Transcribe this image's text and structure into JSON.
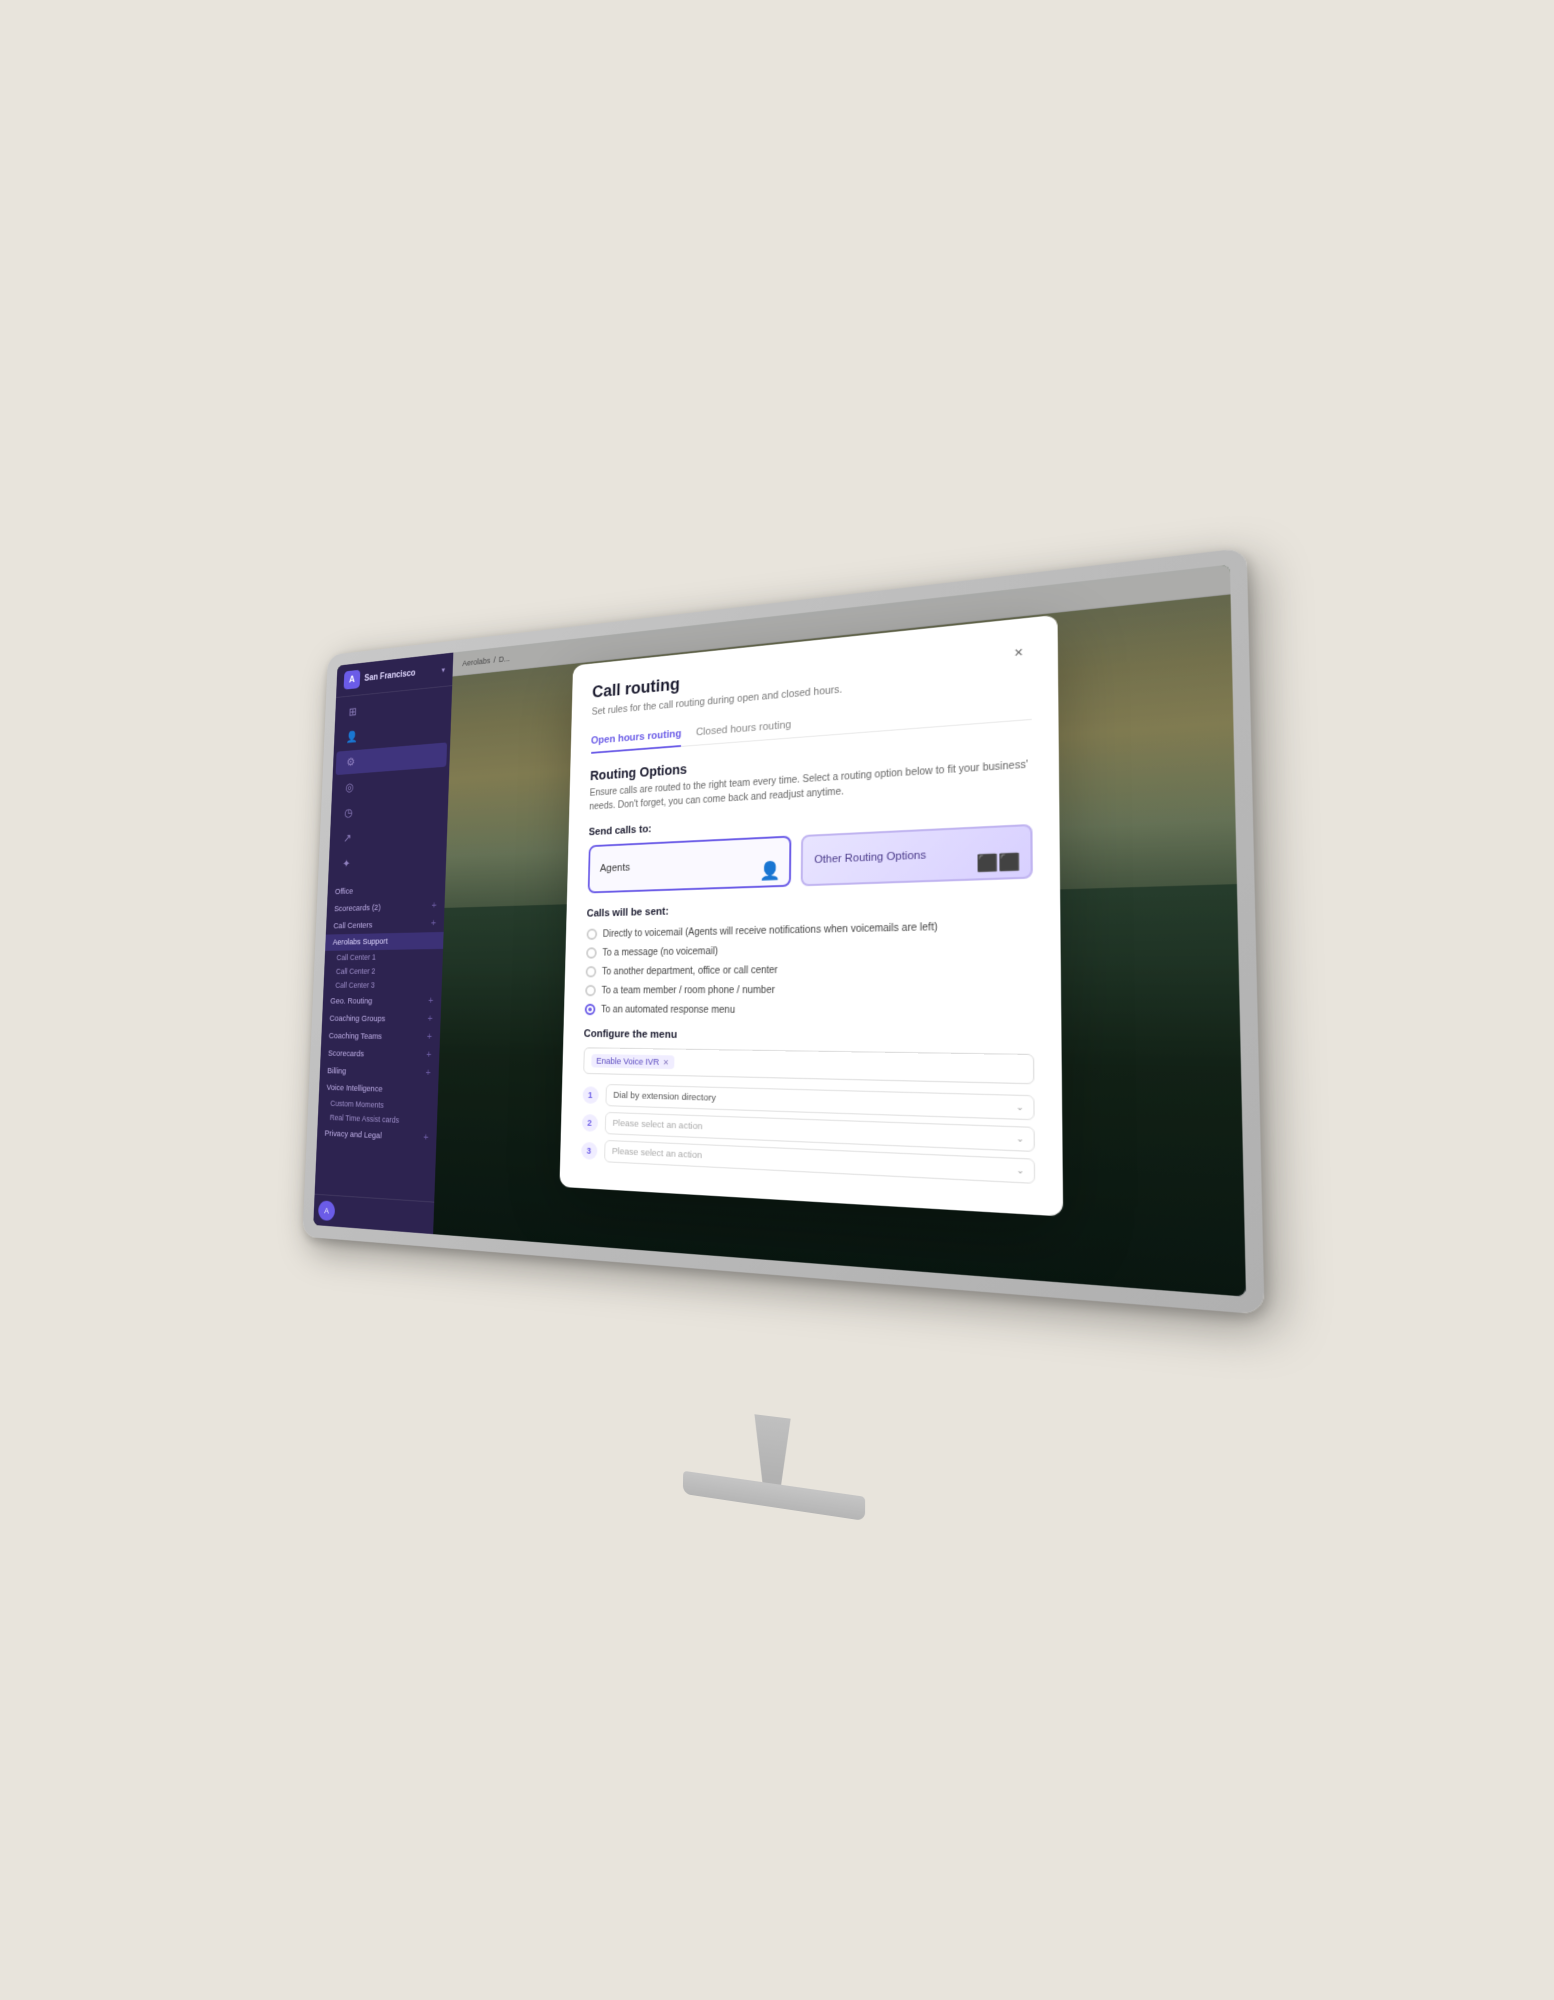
{
  "monitor": {
    "title": "Monitor display"
  },
  "sidebar": {
    "org_name": "San Francisco",
    "logo_text": "A",
    "nav_icons": [
      {
        "name": "grid-icon",
        "symbol": "⊞"
      },
      {
        "name": "users-icon",
        "symbol": "👤"
      },
      {
        "name": "settings-icon",
        "symbol": "⚙"
      },
      {
        "name": "headset-icon",
        "symbol": "🎧"
      },
      {
        "name": "clock-icon",
        "symbol": "◷"
      },
      {
        "name": "chart-icon",
        "symbol": "📈"
      },
      {
        "name": "tools-icon",
        "symbol": "🔧"
      }
    ],
    "items": [
      {
        "label": "Office",
        "indent": 0,
        "has_plus": false
      },
      {
        "label": "Scorecards (2)",
        "indent": 0,
        "has_plus": true
      },
      {
        "label": "Call Centers",
        "indent": 0,
        "has_plus": true
      },
      {
        "label": "Aerolabs Support",
        "indent": 0,
        "has_plus": false,
        "active": true
      },
      {
        "label": "Call Center 1",
        "indent": 1,
        "has_plus": false
      },
      {
        "label": "Call Center 2",
        "indent": 1,
        "has_plus": false
      },
      {
        "label": "Call Center 3",
        "indent": 1,
        "has_plus": false
      },
      {
        "label": "Geo. Routing",
        "indent": 0,
        "has_plus": true
      },
      {
        "label": "Coaching Groups",
        "indent": 0,
        "has_plus": true
      },
      {
        "label": "Coaching Teams",
        "indent": 0,
        "has_plus": true
      },
      {
        "label": "Scorecards",
        "indent": 0,
        "has_plus": true
      },
      {
        "label": "Billing",
        "indent": 0,
        "has_plus": true
      },
      {
        "label": "Voice Intelligence",
        "indent": 0,
        "has_plus": false
      },
      {
        "label": "Custom Moments",
        "indent": 1,
        "has_plus": false
      },
      {
        "label": "Real Time Assist cards",
        "indent": 1,
        "has_plus": false
      },
      {
        "label": "Privacy and Legal",
        "indent": 0,
        "has_plus": true
      }
    ]
  },
  "breadcrumb": {
    "items": [
      "Aerolabs",
      "/",
      "D..."
    ]
  },
  "modal": {
    "title": "Call routing",
    "subtitle": "Set rules for the call routing during open and closed hours.",
    "close_label": "×",
    "tabs": [
      {
        "label": "Open hours routing",
        "active": true
      },
      {
        "label": "Closed hours routing",
        "active": false
      }
    ],
    "routing_options": {
      "title": "Routing Options",
      "description": "Ensure calls are routed to the right team every time. Select a routing option below to fit your business' needs. Don't forget, you can come back and readjust anytime.",
      "send_calls_label": "Send calls to:",
      "cards": [
        {
          "label": "Agents",
          "selected": true,
          "type": "agents"
        },
        {
          "label": "Other Routing Options",
          "selected": false,
          "type": "other"
        }
      ]
    },
    "calls_will_be_sent": {
      "title": "Calls will be sent:",
      "options": [
        {
          "label": "Directly to voicemail (Agents will receive notifications when voicemails are left)",
          "selected": false
        },
        {
          "label": "To a message (no voicemail)",
          "selected": false
        },
        {
          "label": "To another department, office or call center",
          "selected": false
        },
        {
          "label": "To a team member / room phone / number",
          "selected": false
        },
        {
          "label": "To an automated response menu",
          "selected": true
        }
      ]
    },
    "configure_menu": {
      "title": "Configure the menu",
      "tag_label": "Enable Voice IVR",
      "menu_items": [
        {
          "number": "1",
          "value": "Dial by extension directory",
          "is_placeholder": false
        },
        {
          "number": "2",
          "value": "Please select an action",
          "is_placeholder": true
        },
        {
          "number": "3",
          "value": "Please select an action",
          "is_placeholder": true
        }
      ]
    }
  }
}
